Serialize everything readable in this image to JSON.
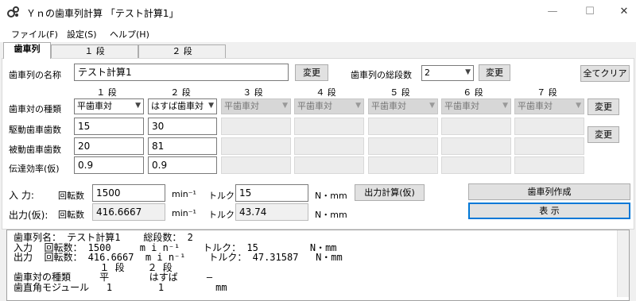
{
  "window": {
    "title": "Ｙｎの歯車列計算 「テスト計算1」"
  },
  "menu": [
    "ファイル(F)",
    "設定(S)",
    "ヘルプ(H)"
  ],
  "tabs": [
    "歯車列",
    "１ 段",
    "２ 段"
  ],
  "form": {
    "name_label": "歯車列の名称",
    "name_value": "テスト計算1",
    "change_label": "変更",
    "stages_label": "歯車列の総段数",
    "stages_value": "2",
    "clear_all_label": "全てクリア",
    "col_headers": [
      "１ 段",
      "２ 段",
      "３ 段",
      "４ 段",
      "５ 段",
      "６ 段",
      "７ 段"
    ],
    "row_labels": [
      "歯車対の種類",
      "駆動歯車歯数",
      "被動歯車歯数",
      "伝達効率(仮)"
    ],
    "gear_types": [
      "平歯車対",
      "はすば歯車対",
      "平歯車対",
      "平歯車対",
      "平歯車対",
      "平歯車対",
      "平歯車対"
    ],
    "driving_teeth": [
      "15",
      "30"
    ],
    "driven_teeth": [
      "20",
      "81"
    ],
    "efficiency": [
      "0.9",
      "0.9"
    ]
  },
  "io": {
    "input_label": "入 力:",
    "output_label": "出力(仮):",
    "speed_label": "回転数",
    "speed_unit": "min⁻¹",
    "torque_label": "トルク",
    "torque_unit": "N・mm",
    "input_speed": "1500",
    "input_torque": "15",
    "output_speed": "416.6667",
    "output_torque": "43.74",
    "calc_button": "出力計算(仮)",
    "create_button": "歯車列作成",
    "display_button": "表 示"
  },
  "output_text": "歯車列名： テスト計算1    総段数： 2\n入力  回転数： 1500     m i n⁻¹    トルク： 15         N・mm\n出力  回転数： 416.6667  m i n⁻¹    トルク： 47.31587   N・mm\n               １ 段    ２ 段\n歯車対の種類     平       はすば     ―\n歯直角モジュール   1        1         mm"
}
